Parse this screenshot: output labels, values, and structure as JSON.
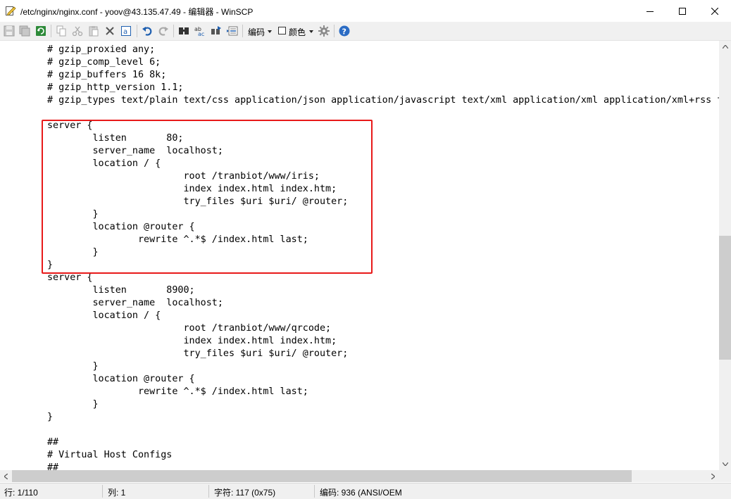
{
  "window": {
    "title": "/etc/nginx/nginx.conf - yoov@43.135.47.49 - 编辑器 - WinSCP",
    "app_icon": "edit-document-icon",
    "controls": [
      "minimize-icon",
      "maximize-icon",
      "close-icon"
    ]
  },
  "toolbar": {
    "encoding_label": "编码",
    "color_label": "颜色",
    "icons": [
      "save-icon",
      "save-all-icon",
      "reload-icon",
      "copy-icon",
      "cut-icon",
      "paste-icon",
      "delete-icon",
      "select-all-icon",
      "undo-icon",
      "redo-icon",
      "find-icon",
      "replace-icon",
      "find-next-icon",
      "goto-line-icon",
      "settings-icon",
      "help-icon"
    ]
  },
  "editor": {
    "lines": [
      "# gzip_proxied any;",
      "# gzip_comp_level 6;",
      "# gzip_buffers 16 8k;",
      "# gzip_http_version 1.1;",
      "# gzip_types text/plain text/css application/json application/javascript text/xml application/xml application/xml+rss t",
      "",
      "server {",
      "        listen       80;",
      "        server_name  localhost;",
      "        location / {",
      "                        root /tranbiot/www/iris;",
      "                        index index.html index.htm;",
      "                        try_files $uri $uri/ @router;",
      "        }",
      "        location @router {",
      "                rewrite ^.*$ /index.html last;",
      "        }",
      "}",
      "server {",
      "        listen       8900;",
      "        server_name  localhost;",
      "        location / {",
      "                        root /tranbiot/www/qrcode;",
      "                        index index.html index.htm;",
      "                        try_files $uri $uri/ @router;",
      "        }",
      "        location @router {",
      "                rewrite ^.*$ /index.html last;",
      "        }",
      "}",
      "",
      "##",
      "# Virtual Host Configs",
      "##"
    ],
    "highlight_color": "#e81919"
  },
  "status": {
    "line": "行: 1/110",
    "column": "列: 1",
    "character": "字符: 117 (0x75)",
    "encoding": "编码: 936  (ANSI/OEM"
  }
}
